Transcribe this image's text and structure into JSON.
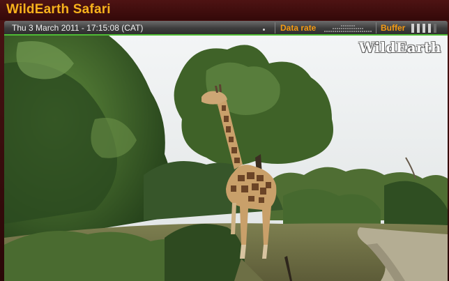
{
  "app": {
    "title": "WildEarth Safari"
  },
  "status_bar": {
    "timestamp": "Thu 3 March 2011 - 17:15:08 (CAT)",
    "data_rate_label": "Data rate",
    "buffer_label": "Buffer",
    "buffer_level_fraction": 0.8
  },
  "video": {
    "watermark": "WildEarth",
    "scene": "giraffe-in-bush"
  },
  "colors": {
    "title": "#f7b21c",
    "label_orange": "#f59a12",
    "status_accent": "#4fbb34",
    "frame_bg": "#3a0f0f"
  }
}
